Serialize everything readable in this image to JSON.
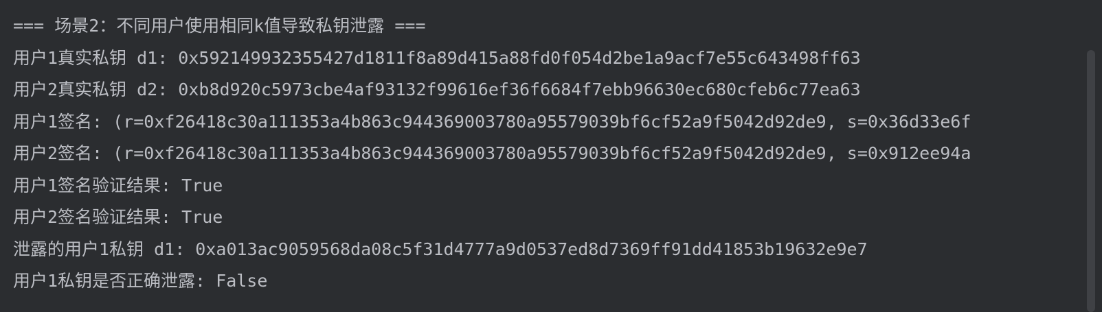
{
  "console": {
    "lines": [
      "=== 场景2：不同用户使用相同k值导致私钥泄露 ===",
      "用户1真实私钥 d1: 0x592149932355427d1811f8a89d415a88fd0f054d2be1a9acf7e55c643498ff63",
      "用户2真实私钥 d2: 0xb8d920c5973cbe4af93132f99616ef36f6684f7ebb96630ec680cfeb6c77ea63",
      "用户1签名: (r=0xf26418c30a111353a4b863c944369003780a95579039bf6cf52a9f5042d92de9, s=0x36d33e6f",
      "用户2签名: (r=0xf26418c30a111353a4b863c944369003780a95579039bf6cf52a9f5042d92de9, s=0x912ee94a",
      "用户1签名验证结果: True",
      "用户2签名验证结果: True",
      "泄露的用户1私钥 d1: 0xa013ac9059568da08c5f31d4777a9d0537ed8d7369ff91dd41853b19632e9e7",
      "用户1私钥是否正确泄露: False"
    ]
  }
}
